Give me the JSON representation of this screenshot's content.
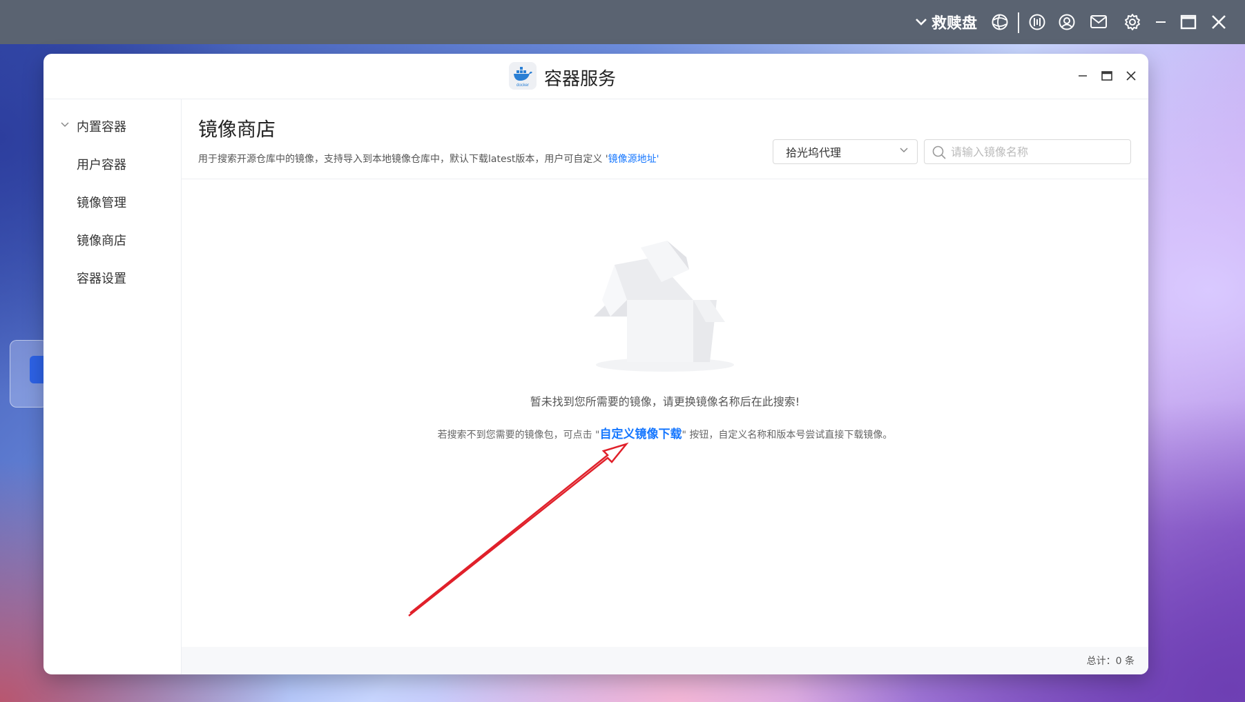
{
  "topbar": {
    "disk_label": "救赎盘",
    "icons": [
      "chevron-down-icon",
      "network-icon",
      "activity-icon",
      "user-icon",
      "mail-icon",
      "gear-icon",
      "minimize-icon",
      "maximize-icon",
      "close-icon"
    ]
  },
  "window": {
    "app_name": "容器服务",
    "app_icon_text": "docker"
  },
  "sidebar": {
    "group_label": "内置容器",
    "items": [
      {
        "label": "用户容器"
      },
      {
        "label": "镜像管理"
      },
      {
        "label": "镜像商店"
      },
      {
        "label": "容器设置"
      }
    ]
  },
  "main": {
    "title": "镜像商店",
    "description": "用于搜索开源仓库中的镜像，支持导入到本地镜像仓库中，默认下载latest版本，用户可自定义 '",
    "description_link": "镜像源地址",
    "description_end": "'",
    "proxy_select": {
      "value": "拾光坞代理"
    },
    "search": {
      "placeholder": "请输入镜像名称"
    },
    "empty": {
      "message": "暂未找到您所需要的镜像，请更换镜像名称后在此搜索!",
      "hint_prefix": "若搜索不到您需要的镜像包，可点击 \"",
      "hint_link": "自定义镜像下载",
      "hint_suffix": "\" 按钮，自定义名称和版本号尝试直接下载镜像。"
    },
    "footer": {
      "total": "总计：0 条"
    }
  },
  "colors": {
    "accent": "#1677ff",
    "arrow": "#e0202a",
    "topbar": "#5a6371"
  }
}
